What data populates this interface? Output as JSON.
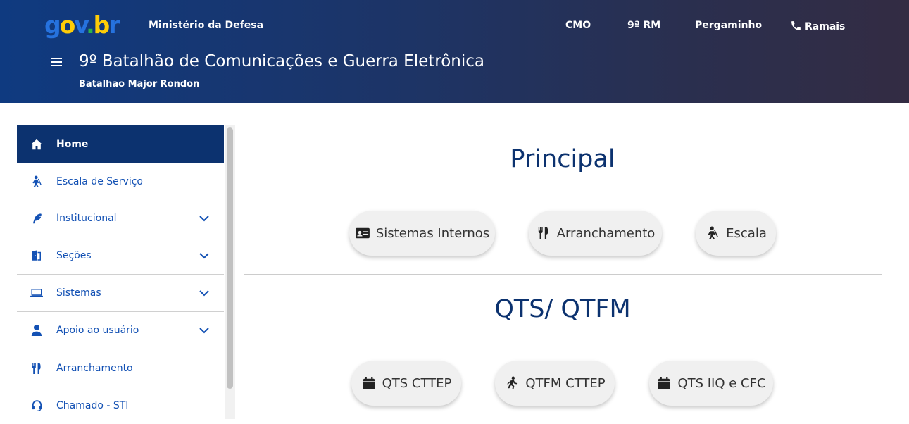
{
  "header": {
    "logo": {
      "g": "g",
      "o": "o",
      "v": "v",
      "dot": ".",
      "b": "b",
      "r": "r"
    },
    "ministry": "Ministério da Defesa",
    "links": [
      {
        "label": "CMO"
      },
      {
        "label": "9ª RM"
      },
      {
        "label": "Pergaminho"
      },
      {
        "label": "Ramais",
        "icon": "phone-icon"
      }
    ],
    "title": "9º Batalhão de Comunicações e Guerra Eletrônica",
    "subtitle": "Batalhão Major Rondon"
  },
  "sidebar": {
    "items": [
      {
        "label": "Home",
        "icon": "home-icon",
        "active": true
      },
      {
        "label": "Escala de Serviço",
        "icon": "soldier-icon"
      },
      {
        "label": "Institucional",
        "icon": "feather-icon",
        "expandable": true
      },
      {
        "label": "Seções",
        "icon": "door-icon",
        "expandable": true
      },
      {
        "label": "Sistemas",
        "icon": "laptop-icon",
        "expandable": true
      },
      {
        "label": "Apoio ao usuário",
        "icon": "user-icon",
        "expandable": true
      },
      {
        "label": "Arranchamento",
        "icon": "utensils-icon"
      },
      {
        "label": "Chamado - STI",
        "icon": "headset-icon"
      }
    ]
  },
  "main": {
    "sections": [
      {
        "title": "Principal",
        "buttons": [
          {
            "label": "Sistemas Internos",
            "icon": "id-card-icon"
          },
          {
            "label": "Arranchamento",
            "icon": "utensils-icon"
          },
          {
            "label": "Escala",
            "icon": "soldier-icon"
          }
        ]
      },
      {
        "title": "QTS/ QTFM",
        "buttons": [
          {
            "label": "QTS CTTEP",
            "icon": "calendar-icon"
          },
          {
            "label": "QTFM CTTEP",
            "icon": "running-icon"
          },
          {
            "label": "QTS IIQ e CFC",
            "icon": "calendar-icon"
          }
        ]
      }
    ]
  },
  "colors": {
    "accent": "#1351b4",
    "active_bg": "#0c326f",
    "title_color": "#0c326f",
    "header_start": "#0f3a80",
    "header_end": "#332c43"
  }
}
